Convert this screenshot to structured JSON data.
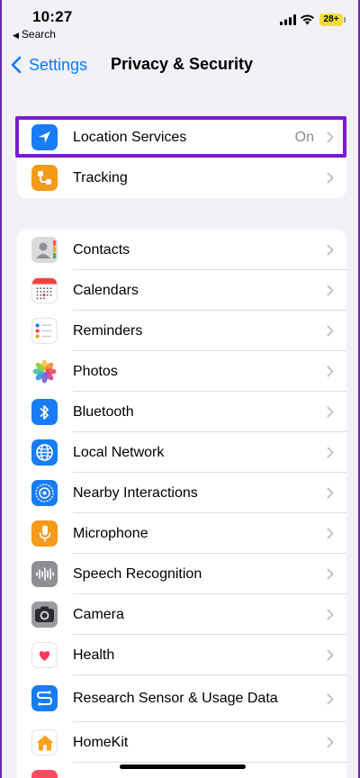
{
  "status_bar": {
    "time": "10:27",
    "back_app": "Search",
    "battery": "28+"
  },
  "nav": {
    "back_label": "Settings",
    "title": "Privacy & Security"
  },
  "group1": [
    {
      "label": "Location Services",
      "value": "On",
      "icon": "location-arrow-icon",
      "color": "#1a7cf5"
    },
    {
      "label": "Tracking",
      "value": "",
      "icon": "tracking-icon",
      "color": "#f59a1b"
    }
  ],
  "group2": [
    {
      "label": "Contacts",
      "icon": "contacts-icon"
    },
    {
      "label": "Calendars",
      "icon": "calendar-icon"
    },
    {
      "label": "Reminders",
      "icon": "reminders-icon"
    },
    {
      "label": "Photos",
      "icon": "photos-icon"
    },
    {
      "label": "Bluetooth",
      "icon": "bluetooth-icon"
    },
    {
      "label": "Local Network",
      "icon": "globe-icon"
    },
    {
      "label": "Nearby Interactions",
      "icon": "nearby-interactions-icon"
    },
    {
      "label": "Microphone",
      "icon": "microphone-icon"
    },
    {
      "label": "Speech Recognition",
      "icon": "waveform-icon"
    },
    {
      "label": "Camera",
      "icon": "camera-icon"
    },
    {
      "label": "Health",
      "icon": "heart-icon"
    },
    {
      "label": "Research Sensor & Usage Data",
      "icon": "research-sensor-icon"
    },
    {
      "label": "HomeKit",
      "icon": "home-icon"
    }
  ],
  "colors": {
    "accent": "#0a7aff",
    "highlight_border": "#7a1bd2",
    "background": "#f2f1f6"
  }
}
